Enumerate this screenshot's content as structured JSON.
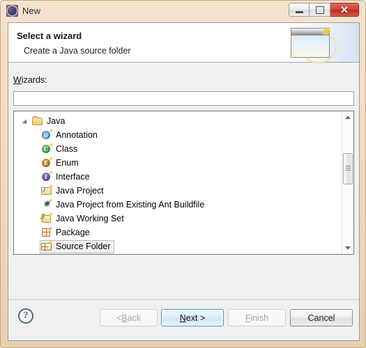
{
  "window": {
    "title": "New",
    "icon": "eclipse-new-wizard-icon",
    "controls": {
      "minimize": "minimize-icon",
      "maximize": "maximize-icon",
      "close": "✕"
    }
  },
  "header": {
    "title": "Select a wizard",
    "description": "Create a Java source folder",
    "banner_icon": "new-wizard-banner-icon",
    "sparkle": "✦"
  },
  "filter": {
    "label_prefix": "W",
    "label_rest": "izards:",
    "value": "",
    "placeholder": ""
  },
  "tree": {
    "items": [
      {
        "label": "Java",
        "icon": "folder-open-icon",
        "level": 0,
        "expanded": true,
        "selected": false
      },
      {
        "label": "Annotation",
        "icon": "annotation-icon",
        "level": 1,
        "expanded": false,
        "selected": false
      },
      {
        "label": "Class",
        "icon": "class-icon",
        "level": 1,
        "expanded": false,
        "selected": false
      },
      {
        "label": "Enum",
        "icon": "enum-icon",
        "level": 1,
        "expanded": false,
        "selected": false
      },
      {
        "label": "Interface",
        "icon": "interface-icon",
        "level": 1,
        "expanded": false,
        "selected": false
      },
      {
        "label": "Java Project",
        "icon": "java-project-icon",
        "level": 1,
        "expanded": false,
        "selected": false
      },
      {
        "label": "Java Project from Existing Ant Buildfile",
        "icon": "ant-buildfile-icon",
        "level": 1,
        "expanded": false,
        "selected": false
      },
      {
        "label": "Java Working Set",
        "icon": "working-set-icon",
        "level": 1,
        "expanded": false,
        "selected": false
      },
      {
        "label": "Package",
        "icon": "package-icon",
        "level": 1,
        "expanded": false,
        "selected": false
      },
      {
        "label": "Source Folder",
        "icon": "source-folder-icon",
        "level": 1,
        "expanded": false,
        "selected": true
      }
    ],
    "scrollbar": {
      "up_arrow": "scroll-up-icon",
      "down_arrow": "scroll-down-icon"
    }
  },
  "buttons": {
    "help": "?",
    "back": {
      "prefix": "< ",
      "mnemonic": "B",
      "suffix": "ack",
      "enabled": false,
      "default": false
    },
    "next": {
      "prefix": "",
      "mnemonic": "N",
      "suffix": "ext >",
      "enabled": true,
      "default": true
    },
    "finish": {
      "prefix": "",
      "mnemonic": "F",
      "suffix": "inish",
      "enabled": false,
      "default": false
    },
    "cancel": {
      "prefix": "",
      "mnemonic": "",
      "suffix": "Cancel",
      "enabled": true,
      "default": false
    }
  },
  "colors": {
    "frame": "#f0d9bf",
    "frame_border": "#c3a882",
    "client_bg": "#f0f0f0",
    "header_bg": "#ffffff",
    "tree_bg": "#ffffff",
    "default_button_border": "#3d9ad4",
    "close_button": "#cf4333",
    "selection_bg": "#f2f1f0",
    "selection_border": "#b9b9b9"
  }
}
